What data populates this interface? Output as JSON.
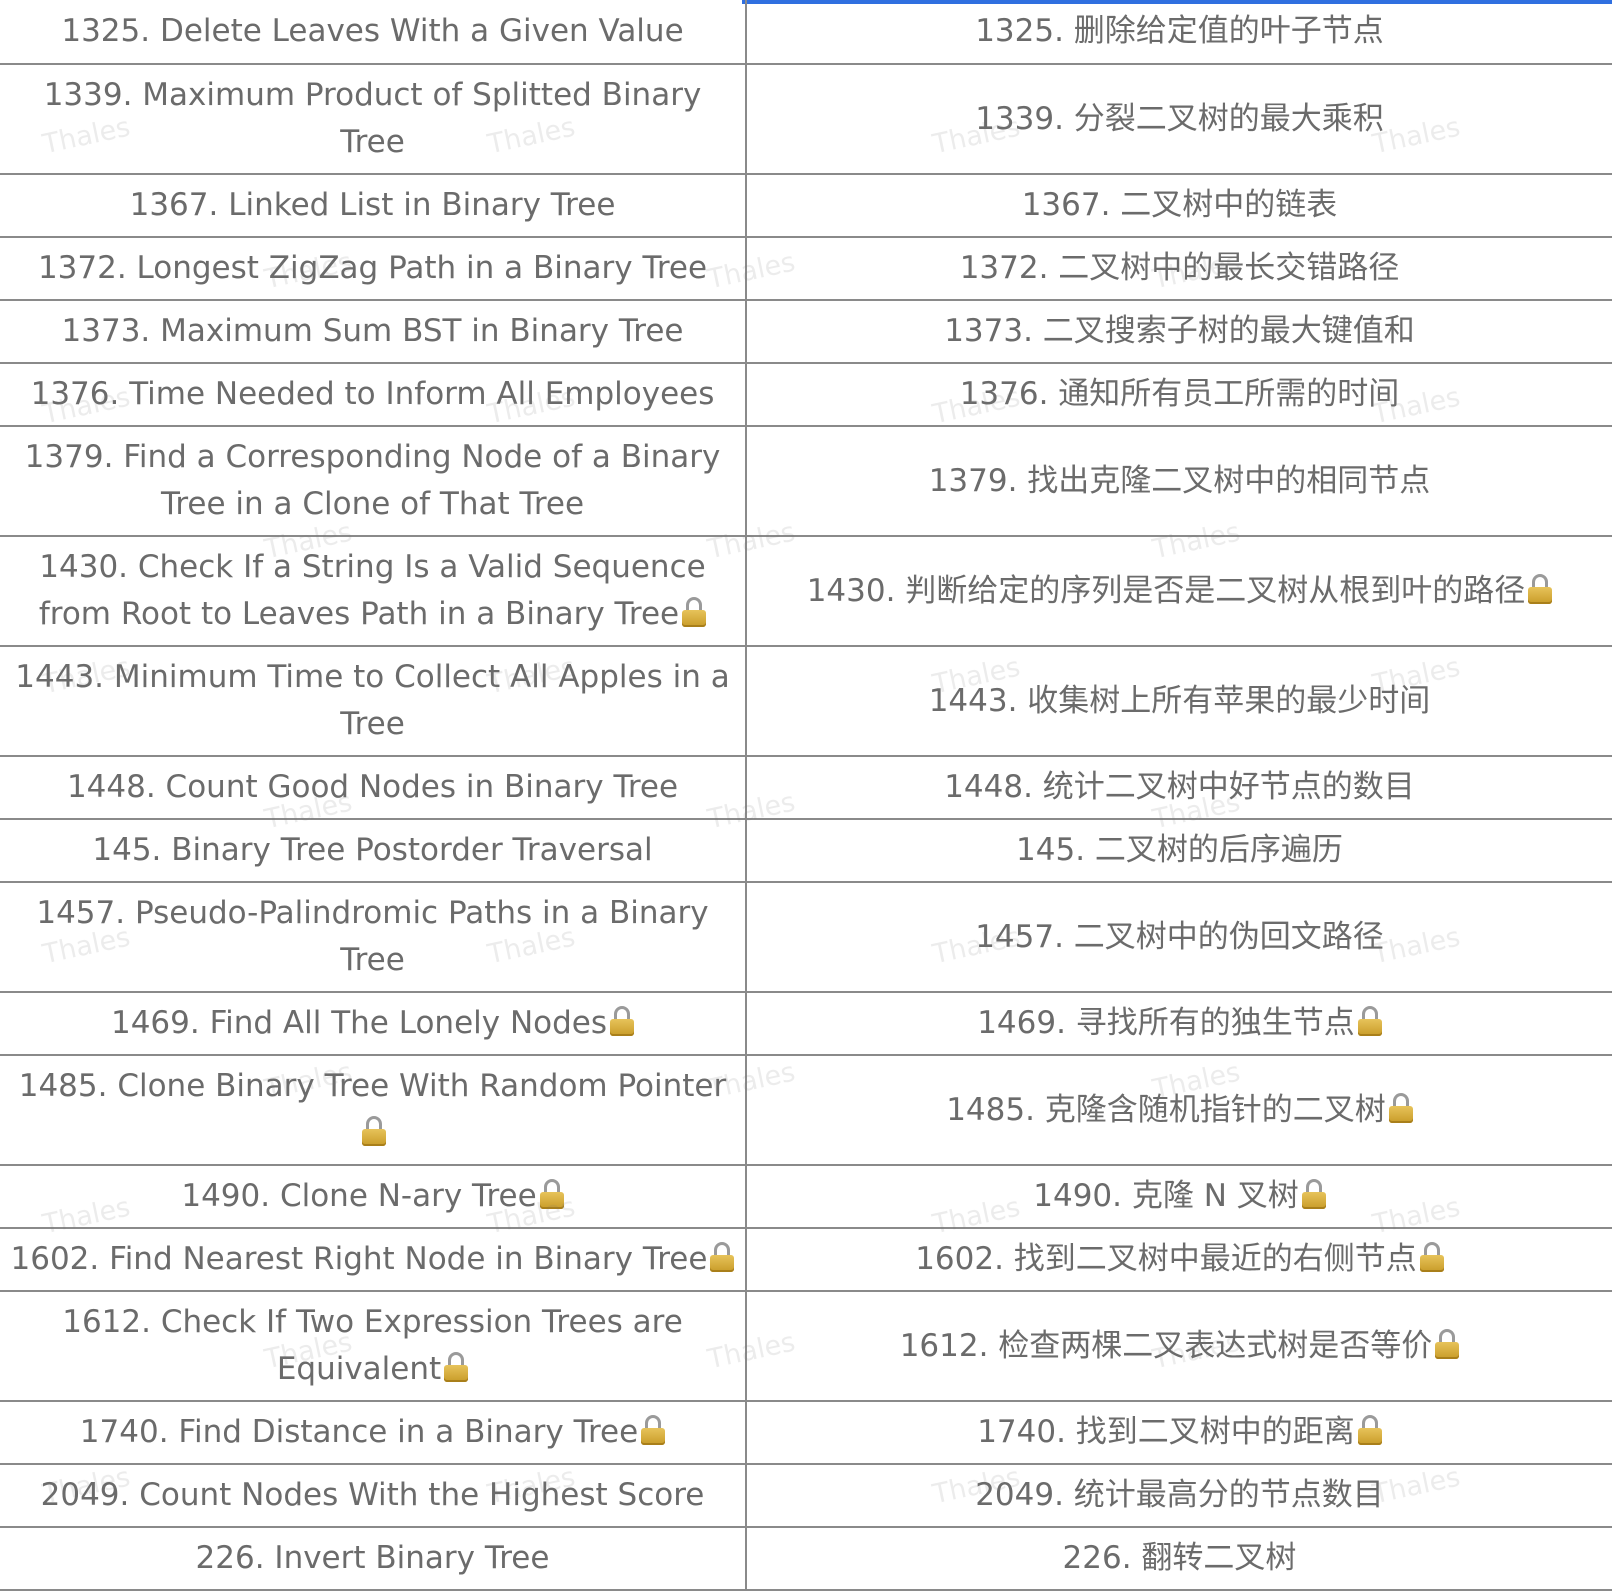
{
  "accent_color": "#2f6fe0",
  "lock_icon": "lock-icon",
  "rows": [
    {
      "en": "1325. Delete Leaves With a Given Value",
      "zh": "1325. 删除给定值的叶子节点",
      "locked": false
    },
    {
      "en": "1339. Maximum Product of Splitted Binary Tree",
      "zh": "1339. 分裂二叉树的最大乘积",
      "locked": false
    },
    {
      "en": "1367. Linked List in Binary Tree",
      "zh": "1367. 二叉树中的链表",
      "locked": false
    },
    {
      "en": "1372. Longest ZigZag Path in a Binary Tree",
      "zh": "1372. 二叉树中的最长交错路径",
      "locked": false
    },
    {
      "en": "1373. Maximum Sum BST in Binary Tree",
      "zh": "1373. 二叉搜索子树的最大键值和",
      "locked": false
    },
    {
      "en": "1376. Time Needed to Inform All Employees",
      "zh": "1376. 通知所有员工所需的时间",
      "locked": false
    },
    {
      "en": "1379. Find a Corresponding Node of a Binary Tree in a Clone of That Tree",
      "zh": "1379. 找出克隆二叉树中的相同节点",
      "locked": false
    },
    {
      "en": "1430. Check If a String Is a Valid Sequence from Root to Leaves Path in a Binary Tree",
      "zh": "1430. 判断给定的序列是否是二叉树从根到叶的路径",
      "locked": true
    },
    {
      "en": "1443. Minimum Time to Collect All Apples in a Tree",
      "zh": "1443. 收集树上所有苹果的最少时间",
      "locked": false
    },
    {
      "en": "1448. Count Good Nodes in Binary Tree",
      "zh": "1448. 统计二叉树中好节点的数目",
      "locked": false
    },
    {
      "en": "145. Binary Tree Postorder Traversal",
      "zh": "145. 二叉树的后序遍历",
      "locked": false
    },
    {
      "en": "1457. Pseudo-Palindromic Paths in a Binary Tree",
      "zh": "1457. 二叉树中的伪回文路径",
      "locked": false
    },
    {
      "en": "1469. Find All The Lonely Nodes",
      "zh": "1469. 寻找所有的独生节点",
      "locked": true
    },
    {
      "en": "1485. Clone Binary Tree With Random Pointer",
      "zh": "1485. 克隆含随机指针的二叉树",
      "locked": true
    },
    {
      "en": "1490. Clone N-ary Tree",
      "zh": "1490. 克隆 N 叉树",
      "locked": true
    },
    {
      "en": "1602. Find Nearest Right Node in Binary Tree",
      "zh": "1602. 找到二叉树中最近的右侧节点",
      "locked": true
    },
    {
      "en": "1612. Check If Two Expression Trees are Equivalent",
      "zh": "1612. 检查两棵二叉表达式树是否等价",
      "locked": true
    },
    {
      "en": "1740. Find Distance in a Binary Tree",
      "zh": "1740. 找到二叉树中的距离",
      "locked": true
    },
    {
      "en": "2049. Count Nodes With the Highest Score",
      "zh": "2049. 统计最高分的节点数目",
      "locked": false
    },
    {
      "en": "226. Invert Binary Tree",
      "zh": "226. 翻转二叉树",
      "locked": false
    }
  ],
  "watermark": "Thales"
}
